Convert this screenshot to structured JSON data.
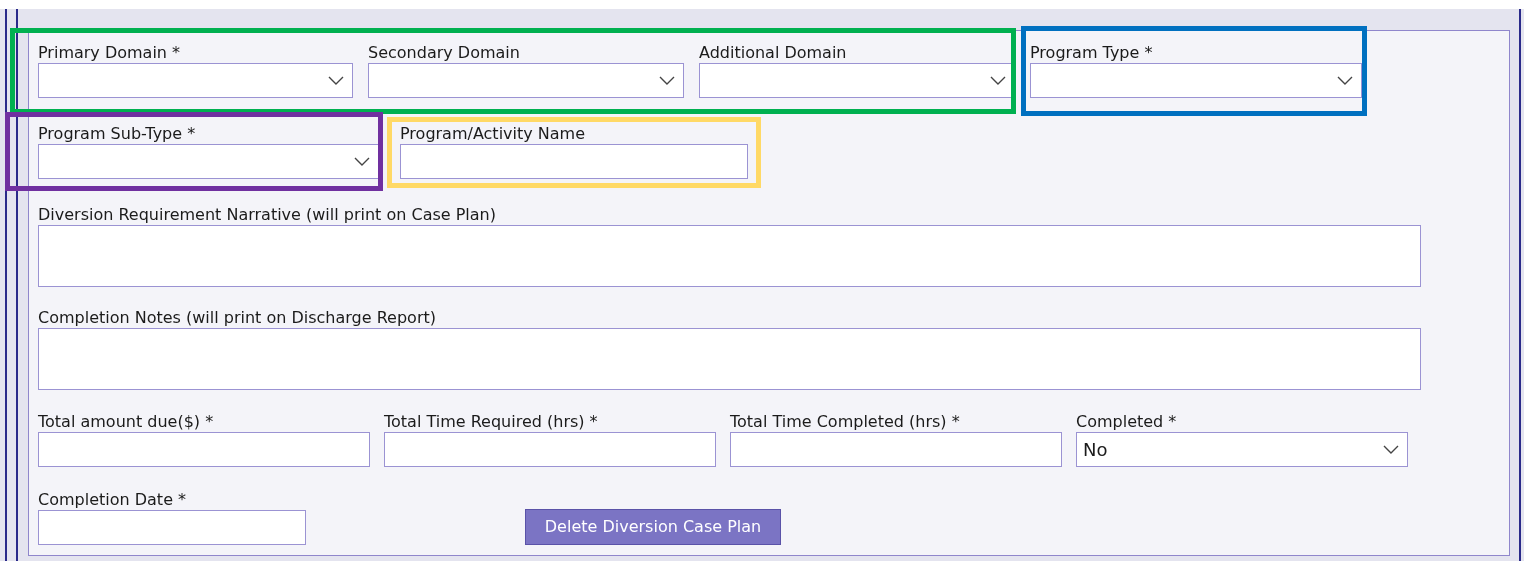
{
  "rows": [
    [
      {
        "kind": "select",
        "label": "Primary Domain *"
      },
      {
        "kind": "select",
        "label": "Secondary Domain"
      },
      {
        "kind": "select",
        "label": "Additional Domain"
      },
      {
        "kind": "select",
        "label": "Program Type *"
      }
    ],
    [
      {
        "kind": "select",
        "label": "Program Sub-Type *"
      },
      {
        "kind": "text",
        "label": "Program/Activity Name"
      }
    ],
    [
      {
        "kind": "textarea",
        "label": "Diversion Requirement Narrative (will print on Case Plan)"
      }
    ],
    [
      {
        "kind": "textarea",
        "label": "Completion Notes (will print on Discharge Report)"
      }
    ],
    [
      {
        "kind": "text",
        "label": "Total amount due($) *"
      },
      {
        "kind": "text",
        "label": "Total Time Required (hrs) *"
      },
      {
        "kind": "text",
        "label": "Total Time Completed (hrs) *"
      },
      {
        "kind": "select",
        "label": "Completed *",
        "value": "No"
      }
    ],
    [
      {
        "kind": "text",
        "label": "Completion Date *"
      },
      {
        "kind": "button",
        "label": "Delete Diversion Case Plan"
      }
    ]
  ],
  "highlights": [
    {
      "color": "#00b050"
    },
    {
      "color": "#0070c0"
    },
    {
      "color": "#7030a0"
    },
    {
      "color": "#ffd966"
    }
  ]
}
